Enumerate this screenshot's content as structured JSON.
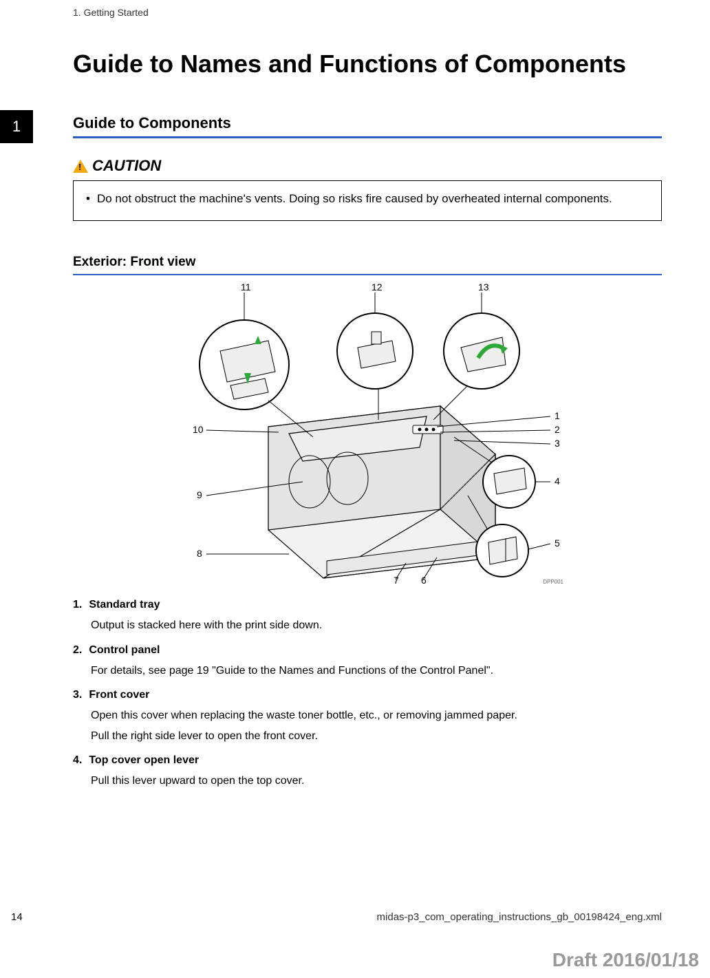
{
  "breadcrumb": "1. Getting Started",
  "title": "Guide to Names and Functions of Components",
  "tab_number": "1",
  "section": {
    "title": "Guide to Components"
  },
  "caution": {
    "label": "CAUTION",
    "text": "Do not obstruct the machine's vents. Doing so risks fire caused by overheated internal components."
  },
  "subheading": "Exterior: Front view",
  "diagram": {
    "callouts": [
      "1",
      "2",
      "3",
      "4",
      "5",
      "6",
      "7",
      "8",
      "9",
      "10",
      "11",
      "12",
      "13"
    ],
    "id": "DPP001"
  },
  "items": [
    {
      "num": "1.",
      "name": "Standard tray",
      "desc": [
        "Output is stacked here with the print side down."
      ]
    },
    {
      "num": "2.",
      "name": "Control panel",
      "desc": [
        "For details, see page 19 \"Guide to the Names and Functions of the Control Panel\"."
      ]
    },
    {
      "num": "3.",
      "name": "Front cover",
      "desc": [
        "Open this cover when replacing the waste toner bottle, etc., or removing jammed paper.",
        "Pull the right side lever to open the front cover."
      ]
    },
    {
      "num": "4.",
      "name": "Top cover open lever",
      "desc": [
        "Pull this lever upward to open the top cover."
      ]
    }
  ],
  "footer": {
    "page": "14",
    "path": "midas-p3_com_operating_instructions_gb_00198424_eng.xml"
  },
  "draft": "Draft 2016/01/18"
}
